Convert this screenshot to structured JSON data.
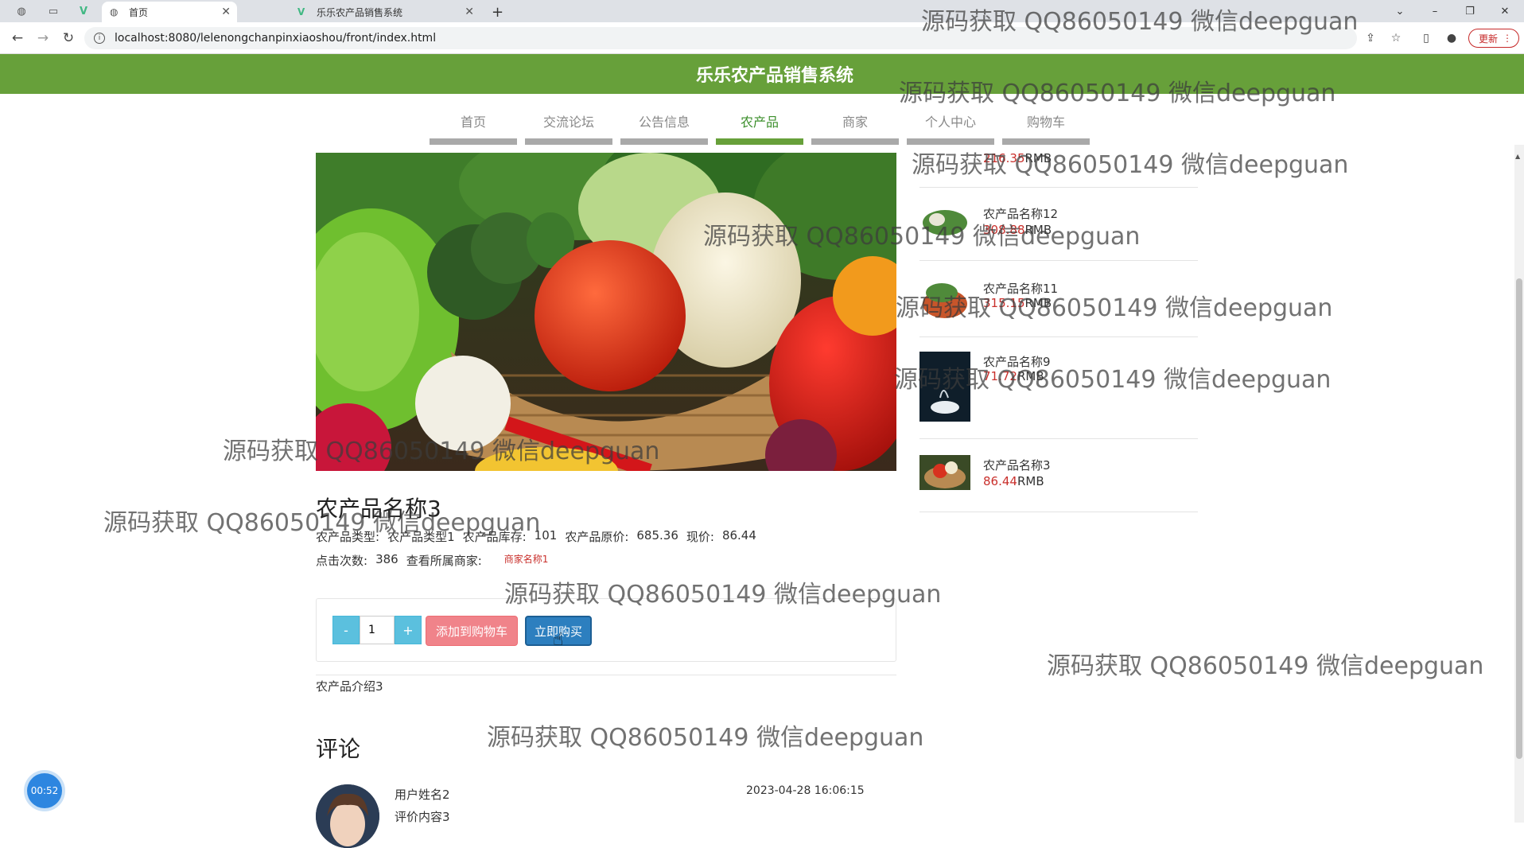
{
  "browser": {
    "tabs": [
      {
        "title": "首页",
        "active": true
      },
      {
        "title": "乐乐农产品销售系统",
        "active": false
      }
    ],
    "new_tab": "+",
    "url": "localhost:8080/lelenongchanpinxiaoshou/front/index.html",
    "update_label": "更新"
  },
  "site": {
    "title": "乐乐农产品销售系统",
    "accent_color": "#67a03a",
    "nav": [
      {
        "label": "首页",
        "active": false
      },
      {
        "label": "交流论坛",
        "active": false
      },
      {
        "label": "公告信息",
        "active": false
      },
      {
        "label": "农产品",
        "active": true
      },
      {
        "label": "商家",
        "active": false
      },
      {
        "label": "个人中心",
        "active": false
      },
      {
        "label": "购物车",
        "active": false
      }
    ]
  },
  "product": {
    "name": "农产品名称3",
    "type_label": "农产品类型:",
    "type_value": "农产品类型1",
    "stock_label": "农产品库存:",
    "stock_value": "101",
    "original_price_label": "农产品原价:",
    "original_price_value": "685.36",
    "current_price_label": "现价:",
    "current_price_value": "86.44",
    "clicks_label": "点击次数:",
    "clicks_value": "386",
    "merchant_label": "查看所属商家:",
    "merchant_link": "商家名称1",
    "quantity": "1",
    "minus_label": "-",
    "plus_label": "+",
    "add_to_cart": "添加到购物车",
    "buy_now": "立即购买",
    "intro": "农产品介绍3"
  },
  "comments": {
    "title": "评论",
    "items": [
      {
        "user": "用户姓名2",
        "content": "评价内容3",
        "time": "2023-04-28 16:06:15"
      }
    ]
  },
  "sidebar": {
    "currency": "RMB",
    "items": [
      {
        "name": "",
        "price": "216.35"
      },
      {
        "name": "农产品名称12",
        "price": "308.88"
      },
      {
        "name": "农产品名称11",
        "price": "315.15"
      },
      {
        "name": "农产品名称9",
        "price": "71.72"
      },
      {
        "name": "农产品名称3",
        "price": "86.44"
      }
    ]
  },
  "watermark_text": "源码获取 QQ86050149 微信deepguan",
  "timer": "00:52",
  "icons": {
    "back": "arrow-left-icon",
    "forward": "arrow-right-icon",
    "reload": "reload-icon",
    "info": "info-icon",
    "share": "share-icon",
    "star": "star-icon",
    "sidepanel": "side-panel-icon",
    "profile": "profile-icon"
  }
}
